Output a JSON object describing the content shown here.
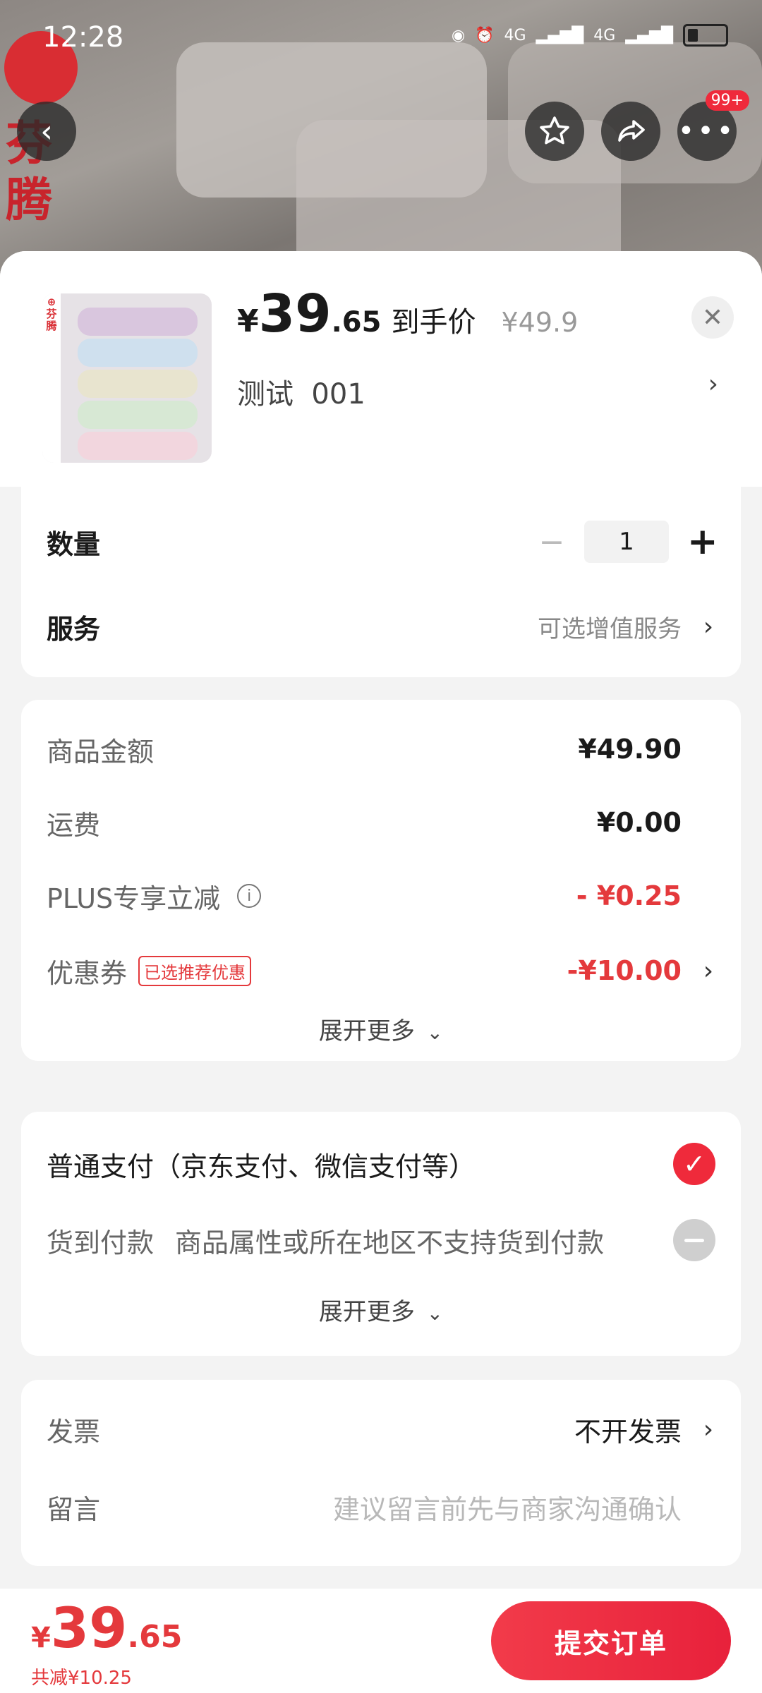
{
  "status_bar": {
    "time": "12:28",
    "network1": "4G",
    "network2": "4G"
  },
  "top_bar": {
    "badge": "99+"
  },
  "brand_bg_chars": [
    "芬",
    "腾"
  ],
  "brand_thumb_text": "芬\n腾",
  "product": {
    "currency": "¥",
    "price_int": "39",
    "price_dec": ".65",
    "price_label": "到手价",
    "original_price": "¥49.9",
    "spec": "测试  001"
  },
  "quantity": {
    "label": "数量",
    "value": "1"
  },
  "service": {
    "label": "服务",
    "value": "可选增值服务"
  },
  "costs": {
    "goods_label": "商品金额",
    "goods_value": "¥49.90",
    "shipping_label": "运费",
    "shipping_value": "¥0.00",
    "plus_label": "PLUS专享立减",
    "plus_value": "- ¥0.25",
    "coupon_label": "优惠券",
    "coupon_tag": "已选推荐优惠",
    "coupon_value": "-¥10.00",
    "expand": "展开更多"
  },
  "payment": {
    "normal": "普通支付（京东支付、微信支付等）",
    "cod_label": "货到付款",
    "cod_note": "商品属性或所在地区不支持货到付款",
    "expand": "展开更多"
  },
  "invoice": {
    "label": "发票",
    "value": "不开发票"
  },
  "message": {
    "label": "留言",
    "placeholder": "建议留言前先与商家沟通确认"
  },
  "footer": {
    "currency": "¥",
    "total_int": "39",
    "total_dec": ".65",
    "saved": "共减¥10.25",
    "submit": "提交订单"
  },
  "colors": {
    "accent": "#e4393c",
    "button": "#ef2a3b"
  }
}
